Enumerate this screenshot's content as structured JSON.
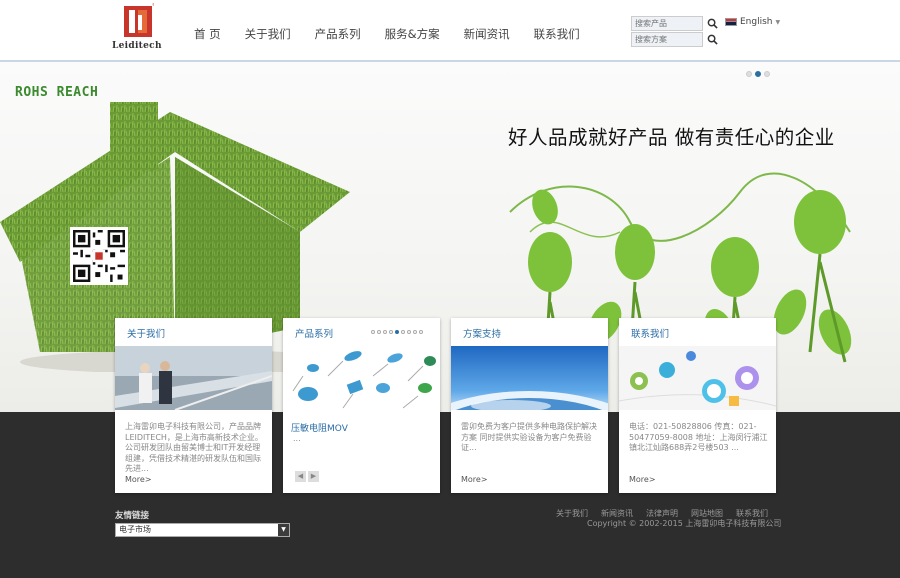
{
  "header": {
    "logo_text": "Leiditech",
    "nav": [
      "首 页",
      "关于我们",
      "产品系列",
      "服务&方案",
      "新闻资讯",
      "联系我们"
    ],
    "search_product_placeholder": "搜索产品",
    "search_solution_placeholder": "搜索方案",
    "language": "English",
    "colors": {
      "brand_red": "#c8362b",
      "nav_text": "#444444"
    }
  },
  "banner": {
    "tag": "ROHS REACH",
    "slogan": "好人品成就好产品  做有责任心的企业",
    "slide_dots": 3,
    "active_slide": 2
  },
  "cards": [
    {
      "title": "关于我们",
      "text": "上海雷卯电子科技有限公司，产品品牌LEIDITECH，是上海市高新技术企业。公司研发团队由留美博士和IT开发经理组建，凭借技术精湛的研发队伍和国际先进...",
      "more": "More>"
    },
    {
      "title": "产品系列",
      "link": "压敏电阻MOV",
      "text": "...",
      "pager_dots": 9,
      "pager_active": 4
    },
    {
      "title": "方案支持",
      "text": "雷卯免费为客户提供多种电路保护解决方案 同时提供实验设备为客户免费验证...",
      "more": "More>"
    },
    {
      "title": "联系我们",
      "text": "电话：021-50828806 传真：021-50477059-8008 地址：上海闵行浦江镇北江灿路688弄2号楼503 ...",
      "more": "More>"
    }
  ],
  "footer": {
    "friend_links_title": "友情链接",
    "friend_links_selected": "电子市场",
    "links": [
      "关于我们",
      "新闻资讯",
      "法律声明",
      "网站地图",
      "联系我们"
    ],
    "copyright": "Copyright © 2002-2015 上海雷卯电子科技有限公司"
  }
}
